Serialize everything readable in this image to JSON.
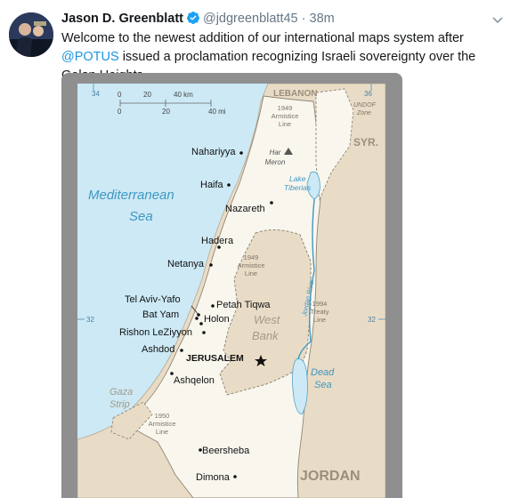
{
  "tweet": {
    "author_name": "Jason D. Greenblatt",
    "handle": "@jdgreenblatt45",
    "separator": "·",
    "time": "38m",
    "text_before": "Welcome to the newest addition of our international maps system after ",
    "mention": "@POTUS",
    "text_after": " issued a proclamation recognizing Israeli sovereignty over the Golan Heights",
    "icons": {
      "verified": "verified-badge-icon",
      "menu": "chevron-down-icon"
    },
    "colors": {
      "link": "#1b95e0",
      "verified": "#1da1f2",
      "muted": "#657786"
    }
  },
  "map": {
    "scale": {
      "deg": "34",
      "top_ticks": [
        "0",
        "20",
        "40 km"
      ],
      "bottom_ticks": [
        "0",
        "20",
        "40 mi"
      ]
    },
    "grid_labels": {
      "lon_right": "36",
      "lat_left": "32",
      "lat_right": "32"
    },
    "countries": {
      "lebanon": "LEBANON",
      "syria": "SYR.",
      "jordan": "JORDAN"
    },
    "undof": [
      "UNDOF",
      "Zone"
    ],
    "armistice_1949_north": [
      "1949",
      "Armistice",
      "Line"
    ],
    "armistice_1949_west": [
      "1949",
      "Armistice",
      "Line"
    ],
    "armistice_1950": [
      "1950",
      "Armistice",
      "Line"
    ],
    "treaty_1994": [
      "1994",
      "Treaty",
      "Line"
    ],
    "peak": [
      "Har",
      "Meron"
    ],
    "lake": [
      "Lake",
      "Tiberias"
    ],
    "river": "Jordan River",
    "sea": [
      "Mediterranean",
      "Sea"
    ],
    "dead_sea": [
      "Dead",
      "Sea"
    ],
    "west_bank": [
      "West",
      "Bank"
    ],
    "gaza": [
      "Gaza",
      "Strip"
    ],
    "cities": {
      "nahariyya": "Nahariyya",
      "haifa": "Haifa",
      "nazareth": "Nazareth",
      "hadera": "Hadera",
      "netanya": "Netanya",
      "tel_aviv": "Tel Aviv-Yafo",
      "petah_tiqwa": "Petah Tiqwa",
      "bat_yam": "Bat Yam",
      "holon": "Holon",
      "rishon": "Rishon LeZiyyon",
      "ashdod": "Ashdod",
      "jerusalem": "JERUSALEM",
      "ashqelon": "Ashqelon",
      "beersheba": "Beersheba",
      "dimona": "Dimona"
    },
    "colors": {
      "water": "#cce9f5",
      "land_israel": "#f9f6ee",
      "land_other": "#e9dcc7",
      "water_text": "#3f97c2"
    }
  }
}
